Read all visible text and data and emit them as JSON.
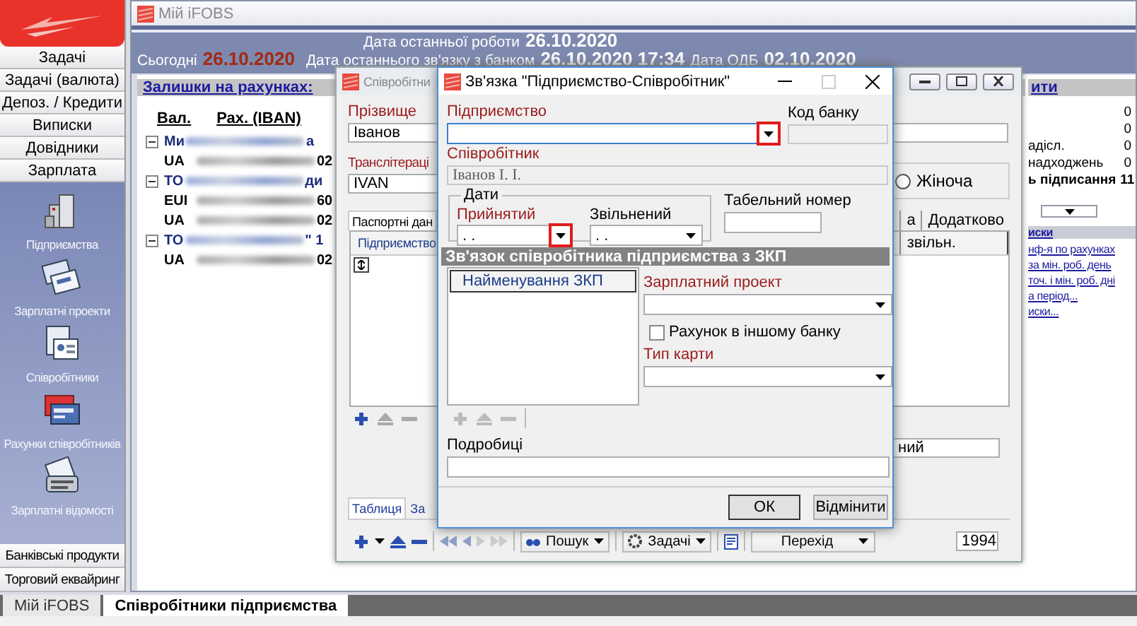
{
  "sidebar": {
    "menu": [
      {
        "label": "Задачі"
      },
      {
        "label": "Задачі (валюта)"
      },
      {
        "label": "Депоз. / Кредити"
      },
      {
        "label": "Виписки"
      },
      {
        "label": "Довідники"
      },
      {
        "label": "Зарплата"
      }
    ],
    "tools": [
      {
        "label": "Підприємства",
        "kind": "building"
      },
      {
        "label": "Зарплатні проекти",
        "kind": "cards"
      },
      {
        "label": "Співробітники",
        "kind": "staff"
      },
      {
        "label": "Рахунки співробітників",
        "kind": "card"
      },
      {
        "label": "Зарплатні відомості",
        "kind": "sheet"
      }
    ],
    "bottom_menu": [
      {
        "label": "Банківські продукти"
      },
      {
        "label": "Торговий еквайринг"
      }
    ]
  },
  "window": {
    "title": "Мій iFOBS"
  },
  "header": {
    "last_work_label": "Дата останньої роботи",
    "last_work": "26.10.2020",
    "today_label": "Сьогодні",
    "today": "26.10.2020",
    "last_link_label": "Дата останнього зв'язку з банком",
    "last_link": "26.10.2020 17:34",
    "odb_label": "Дата ОДБ",
    "odb": "02.10.2020"
  },
  "balances": {
    "title": "Залишки на рахунках:",
    "columns": [
      "Вал.",
      "Рах. (IBAN)"
    ],
    "groups": [
      {
        "name": "Ми",
        "tail": "а",
        "expanded": true,
        "children": [
          {
            "code": "UA",
            "tail": "02"
          }
        ]
      },
      {
        "name": "ТО",
        "tail": "ди",
        "expanded": true,
        "children": [
          {
            "code": "EUI",
            "tail": "60"
          },
          {
            "code": "UA",
            "tail": "02"
          }
        ]
      },
      {
        "name": "ТО",
        "tail": "\" 1",
        "expanded": true,
        "children": [
          {
            "code": "UA",
            "tail": "02"
          }
        ]
      }
    ]
  },
  "right_panel": {
    "link": "ити",
    "counts": [
      {
        "value": "0",
        "bold": false
      },
      {
        "value": "0",
        "bold": false
      },
      {
        "label": "адісл.",
        "value": "0",
        "bold": false
      },
      {
        "label": "надходжень",
        "value": "0",
        "bold": false
      },
      {
        "label": "ь підписання",
        "value": "11",
        "bold": true
      }
    ],
    "links_title": "иски",
    "links": [
      "нф-я по рахунках",
      "за мін. роб. день",
      "точ. і мін. роб. дні",
      "а період...",
      "иски..."
    ]
  },
  "background_window": {
    "title": "Співробітни",
    "surname_label": "Прізвище",
    "surname": "Іванов",
    "translit_label": "Транслітераці",
    "translit": "IVAN",
    "gender_option": {
      "label": "Жіноча",
      "selected": false
    },
    "tabs": [
      {
        "label": "Паспортні дан",
        "selected": true
      },
      {
        "label": "а",
        "selected": false
      },
      {
        "label": "Додатково",
        "selected": false
      }
    ],
    "grid_columns": [
      "Підприємство",
      "звільн."
    ],
    "field_tail": "ний",
    "bottom_tabs": [
      {
        "label": "Таблиця",
        "selected": true
      },
      {
        "label": "За",
        "selected": false
      }
    ],
    "toolbar": {
      "search": "Пошук",
      "tasks": "Задачі",
      "goto": "Перехід"
    },
    "counter": "1994"
  },
  "dialog": {
    "title": "Зв'язка \"Підприємство-Співробітник\"",
    "enterprise": {
      "label": "Підприємство",
      "required": true,
      "highlighted": true
    },
    "bank_code": {
      "label": "Код банку",
      "required": false
    },
    "employee": {
      "label": "Співробітник",
      "required": true,
      "value": "Іванов І. І."
    },
    "dates_group": "Дати",
    "hired": {
      "label": "Прийнятий",
      "required": true,
      "value": ". .",
      "highlighted": true
    },
    "fired": {
      "label": "Звільнений",
      "required": false,
      "value": ". .",
      "highlighted": false
    },
    "tab_number": {
      "label": "Табельний номер",
      "required": false
    },
    "section": "Зв'язок співробітника підприємства з ЗКП",
    "zkp_column": "Найменування ЗКП",
    "salary_project": {
      "label": "Зарплатний проект",
      "required": true
    },
    "other_bank": {
      "label": "Рахунок в іншому банку",
      "checked": false
    },
    "card_type": {
      "label": "Тип карти",
      "required": true
    },
    "details": {
      "label": "Подробиці",
      "required": false
    },
    "buttons": [
      {
        "label": "ОК",
        "kind": "default"
      },
      {
        "label": "Відмінити",
        "kind": "normal"
      }
    ]
  },
  "bottom_tabs": [
    {
      "label": "Мій iFOBS",
      "selected": false
    },
    {
      "label": "Співробітники підприємства",
      "selected": true
    }
  ]
}
